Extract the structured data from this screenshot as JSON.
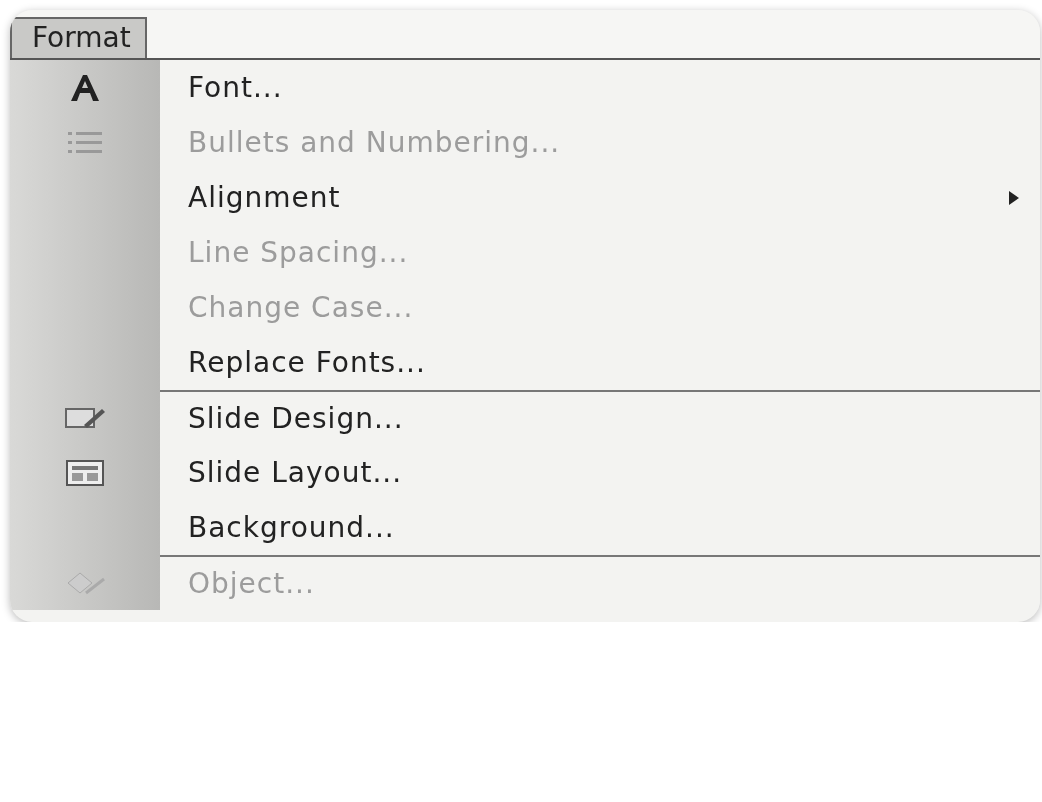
{
  "menu_bar": {
    "title": "Format",
    "selected": true
  },
  "menu": {
    "items": [
      {
        "label": "Font...",
        "disabled": false,
        "separator_before": false,
        "submenu": false
      },
      {
        "label": "Bullets and Numbering...",
        "disabled": true,
        "separator_before": false,
        "submenu": false
      },
      {
        "label": "Alignment",
        "disabled": false,
        "separator_before": false,
        "submenu": true
      },
      {
        "label": "Line Spacing...",
        "disabled": true,
        "separator_before": false,
        "submenu": false
      },
      {
        "label": "Change Case...",
        "disabled": true,
        "separator_before": false,
        "submenu": false
      },
      {
        "label": "Replace Fonts...",
        "disabled": false,
        "separator_before": false,
        "submenu": false
      },
      {
        "label": "Slide Design...",
        "disabled": false,
        "separator_before": true,
        "submenu": false
      },
      {
        "label": "Slide Layout...",
        "disabled": false,
        "separator_before": false,
        "submenu": false
      },
      {
        "label": "Background...",
        "disabled": false,
        "separator_before": false,
        "submenu": false
      },
      {
        "label": "Object...",
        "disabled": true,
        "separator_before": true,
        "submenu": false
      }
    ]
  }
}
